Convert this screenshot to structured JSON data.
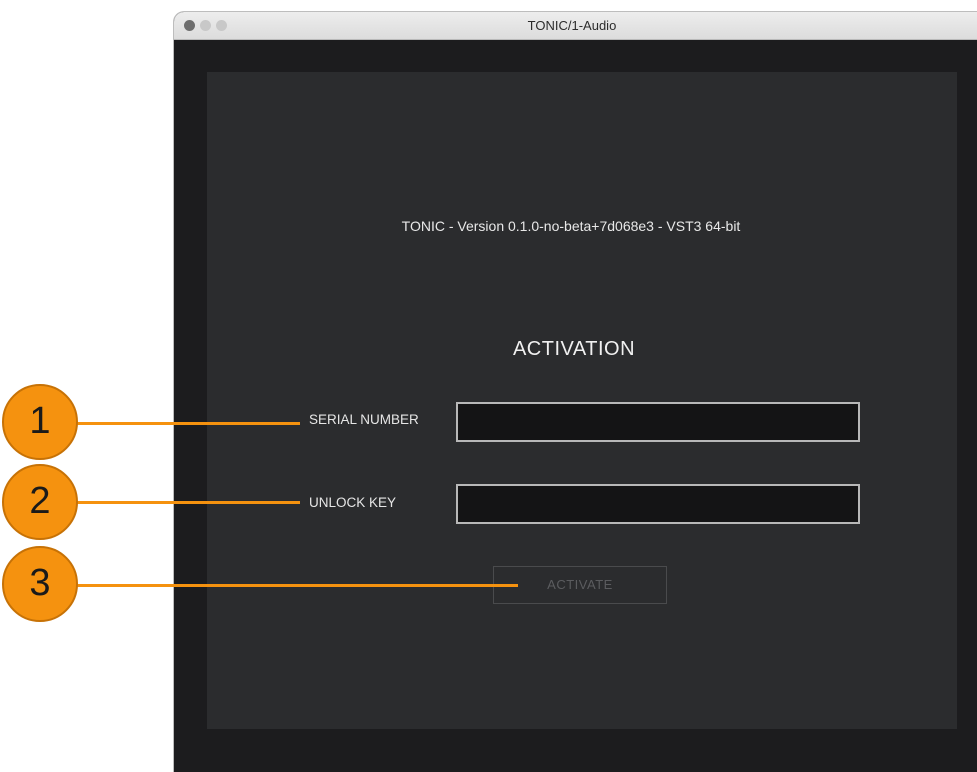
{
  "window": {
    "title": "TONIC/1-Audio"
  },
  "plugin": {
    "version_text": "TONIC - Version 0.1.0-no-beta+7d068e3 - VST3 64-bit",
    "heading": "ACTIVATION",
    "serial_label": "SERIAL NUMBER",
    "serial_value": "",
    "unlock_label": "UNLOCK KEY",
    "unlock_value": "",
    "activate_label": "ACTIVATE"
  },
  "callouts": [
    "1",
    "2",
    "3"
  ],
  "colors": {
    "callout": "#f5920f",
    "panel": "#2b2c2e",
    "window": "#1c1c1e"
  }
}
